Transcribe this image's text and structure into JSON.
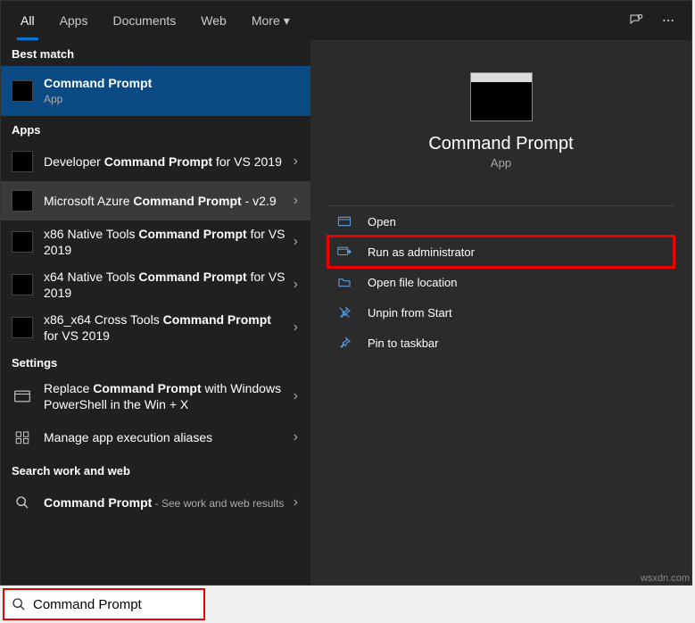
{
  "tabs": {
    "all": "All",
    "apps": "Apps",
    "documents": "Documents",
    "web": "Web",
    "more": "More"
  },
  "sections": {
    "best": "Best match",
    "apps": "Apps",
    "settings": "Settings",
    "searchweb": "Search work and web"
  },
  "best": {
    "title": "Command Prompt",
    "sub": "App"
  },
  "apps": {
    "a0": {
      "pre": "Developer ",
      "bold": "Command Prompt",
      "post": " for VS 2019"
    },
    "a1": {
      "pre": "Microsoft Azure ",
      "bold": "Command Prompt",
      "post": " - v2.9"
    },
    "a2": {
      "pre": "x86 Native Tools ",
      "bold": "Command Prompt",
      "post": " for VS 2019"
    },
    "a3": {
      "pre": "x64 Native Tools ",
      "bold": "Command Prompt",
      "post": " for VS 2019"
    },
    "a4": {
      "pre": "x86_x64 Cross Tools ",
      "bold": "Command Prompt",
      "post": " for VS 2019"
    }
  },
  "settings": {
    "s0": {
      "pre": "Replace ",
      "bold": "Command Prompt",
      "post": " with Windows PowerShell in the Win + X"
    },
    "s1": {
      "text": "Manage app execution aliases"
    }
  },
  "webresult": {
    "bold": "Command Prompt",
    "post": " - See work and web results"
  },
  "preview": {
    "title": "Command Prompt",
    "sub": "App"
  },
  "actions": {
    "open": "Open",
    "runadmin": "Run as administrator",
    "openloc": "Open file location",
    "unpin": "Unpin from Start",
    "pintb": "Pin to taskbar"
  },
  "searchbox": {
    "value": "Command Prompt"
  },
  "watermark": "wsxdn.com"
}
